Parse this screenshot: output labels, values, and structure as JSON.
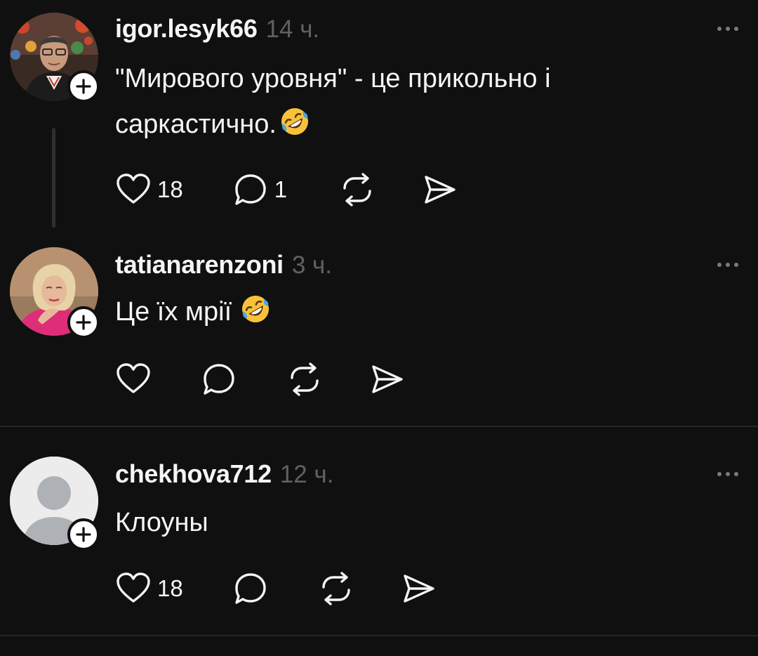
{
  "theme": {
    "background": "#101010",
    "text": "#f3f5f7",
    "muted": "#616161",
    "divider": "#262626"
  },
  "posts": [
    {
      "username": "igor.lesyk66",
      "time": "14 ч.",
      "text": "\"Мирового уровня\" - це прикольно і саркастично.",
      "emoji": "rolling-on-floor-laughing-icon",
      "likes": "18",
      "replies": "1"
    },
    {
      "username": "tatianarenzoni",
      "time": "3 ч.",
      "text": "Це їх мрії",
      "emoji": "rolling-on-floor-laughing-icon",
      "likes": "",
      "replies": ""
    },
    {
      "username": "chekhova712",
      "time": "12 ч.",
      "text": "Клоуны",
      "likes": "18",
      "replies": ""
    }
  ]
}
